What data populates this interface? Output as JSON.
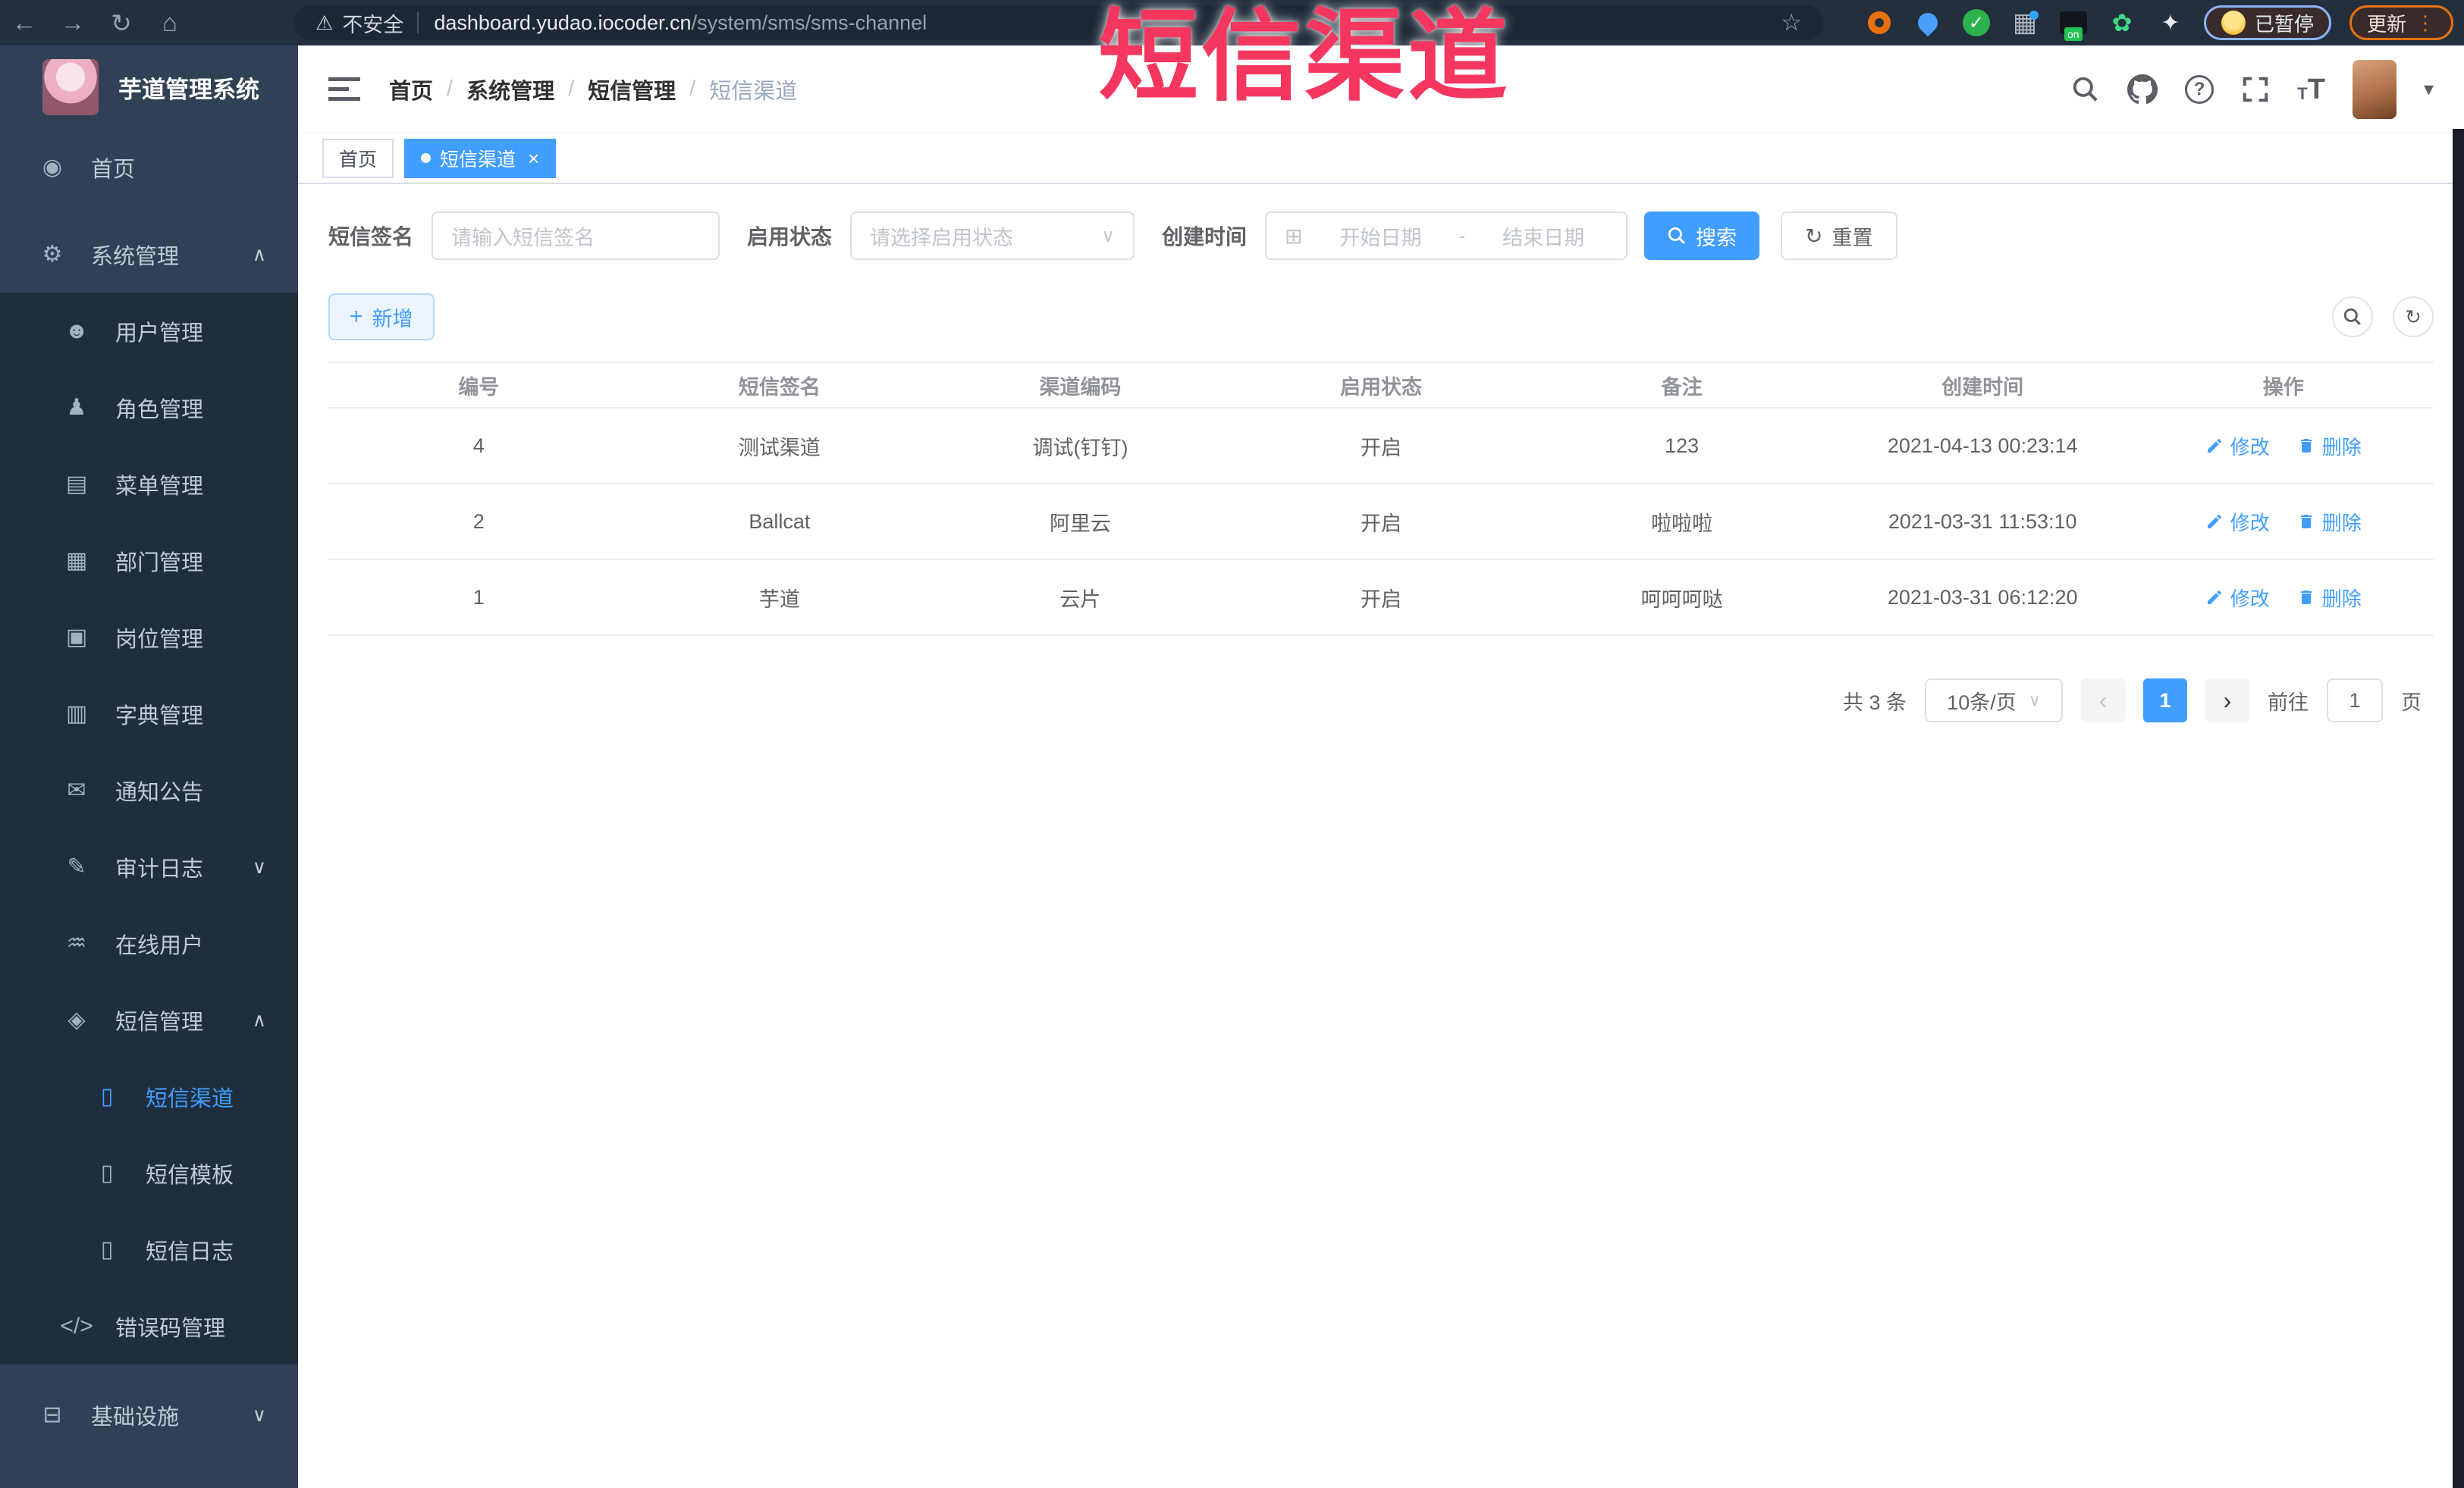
{
  "colors": {
    "accent": "#409eff",
    "watermark": "#f5375f"
  },
  "watermark": {
    "text": "短信渠道"
  },
  "browser": {
    "security_label": "不安全",
    "url_host": "dashboard.yudao.iocoder.cn",
    "url_path": "/system/sms/sms-channel",
    "paused_label": "已暂停",
    "update_label": "更新"
  },
  "sidebar": {
    "app_title": "芋道管理系统",
    "items": [
      {
        "key": "home",
        "label": "首页",
        "icon": "dashboard",
        "level": 1
      },
      {
        "key": "system-mgmt",
        "label": "系统管理",
        "icon": "gear",
        "level": 1,
        "chevron": "up",
        "cls": "mt-sys"
      },
      {
        "key": "user-mgmt",
        "label": "用户管理",
        "icon": "user",
        "level": 2
      },
      {
        "key": "role-mgmt",
        "label": "角色管理",
        "icon": "role",
        "level": 2
      },
      {
        "key": "menu-mgmt",
        "label": "菜单管理",
        "icon": "menu",
        "level": 2
      },
      {
        "key": "dept-mgmt",
        "label": "部门管理",
        "icon": "dept",
        "level": 2
      },
      {
        "key": "post-mgmt",
        "label": "岗位管理",
        "icon": "post",
        "level": 2
      },
      {
        "key": "dict-mgmt",
        "label": "字典管理",
        "icon": "dict",
        "level": 2
      },
      {
        "key": "notice",
        "label": "通知公告",
        "icon": "notice",
        "level": 2
      },
      {
        "key": "audit-log",
        "label": "审计日志",
        "icon": "log",
        "level": 2,
        "chevron": "down"
      },
      {
        "key": "online-users",
        "label": "在线用户",
        "icon": "online",
        "level": 2
      },
      {
        "key": "sms-mgmt",
        "label": "短信管理",
        "icon": "sms",
        "level": 2,
        "chevron": "up"
      },
      {
        "key": "sms-channel",
        "label": "短信渠道",
        "icon": "phone",
        "level": 3,
        "active": true
      },
      {
        "key": "sms-template",
        "label": "短信模板",
        "icon": "phone",
        "level": 3
      },
      {
        "key": "sms-log",
        "label": "短信日志",
        "icon": "phone",
        "level": 3
      },
      {
        "key": "error-code",
        "label": "错误码管理",
        "icon": "code",
        "level": 2
      },
      {
        "key": "infrastructure",
        "label": "基础设施",
        "icon": "infra",
        "level": 1,
        "chevron": "down",
        "cls": "mt-infra"
      }
    ]
  },
  "header": {
    "breadcrumb": [
      "首页",
      "系统管理",
      "短信管理",
      "短信渠道"
    ]
  },
  "tabs": [
    {
      "key": "home",
      "label": "首页",
      "active": false,
      "closable": false
    },
    {
      "key": "sms-channel",
      "label": "短信渠道",
      "active": true,
      "closable": true
    }
  ],
  "filters": {
    "sign_label": "短信签名",
    "sign_placeholder": "请输入短信签名",
    "status_label": "启用状态",
    "status_placeholder": "请选择启用状态",
    "time_label": "创建时间",
    "start_placeholder": "开始日期",
    "range_separator": "-",
    "end_placeholder": "结束日期",
    "search_label": "搜索",
    "reset_label": "重置"
  },
  "toolbar": {
    "add_label": "新增"
  },
  "table": {
    "columns": [
      "编号",
      "短信签名",
      "渠道编码",
      "启用状态",
      "备注",
      "创建时间",
      "操作"
    ],
    "rows": [
      {
        "id": "4",
        "sign": "测试渠道",
        "code": "调试(钉钉)",
        "status": "开启",
        "remark": "123",
        "created": "2021-04-13 00:23:14"
      },
      {
        "id": "2",
        "sign": "Ballcat",
        "code": "阿里云",
        "status": "开启",
        "remark": "啦啦啦",
        "created": "2021-03-31 11:53:10"
      },
      {
        "id": "1",
        "sign": "芋道",
        "code": "云片",
        "status": "开启",
        "remark": "呵呵呵哒",
        "created": "2021-03-31 06:12:20"
      }
    ],
    "edit_label": "修改",
    "delete_label": "删除"
  },
  "pagination": {
    "total_label": "共 3 条",
    "page_size": "10条/页",
    "current_page": "1",
    "goto_label": "前往",
    "goto_value": "1",
    "unit_label": "页"
  },
  "icons": {
    "back": "←",
    "forward": "→",
    "reload": "↻",
    "home": "⌂",
    "warning": "⚠",
    "star": "☆",
    "check": "✓",
    "ext_grid": "▦",
    "ext_leaf": "✿",
    "ext_puzzle": "✦",
    "dots_v": "⋮",
    "on_badge": "on",
    "caret_down": "▾",
    "chevron_up": "∧",
    "chevron_down": "∨",
    "select_arrow": "∨",
    "calendar": "⊞",
    "refresh": "↻",
    "plus": "+",
    "close": "×",
    "sep": "/",
    "prev": "‹",
    "next": "›",
    "question": "?",
    "font_t": "T",
    "dashboard": "◉",
    "gear": "⚙",
    "user": "☻",
    "role": "♟",
    "menu": "▤",
    "dept": "▦",
    "post": "▣",
    "dict": "▥",
    "notice": "✉",
    "log": "✎",
    "online": "♒",
    "sms": "◈",
    "phone": "▯",
    "code": "</>",
    "infra": "⊟"
  }
}
